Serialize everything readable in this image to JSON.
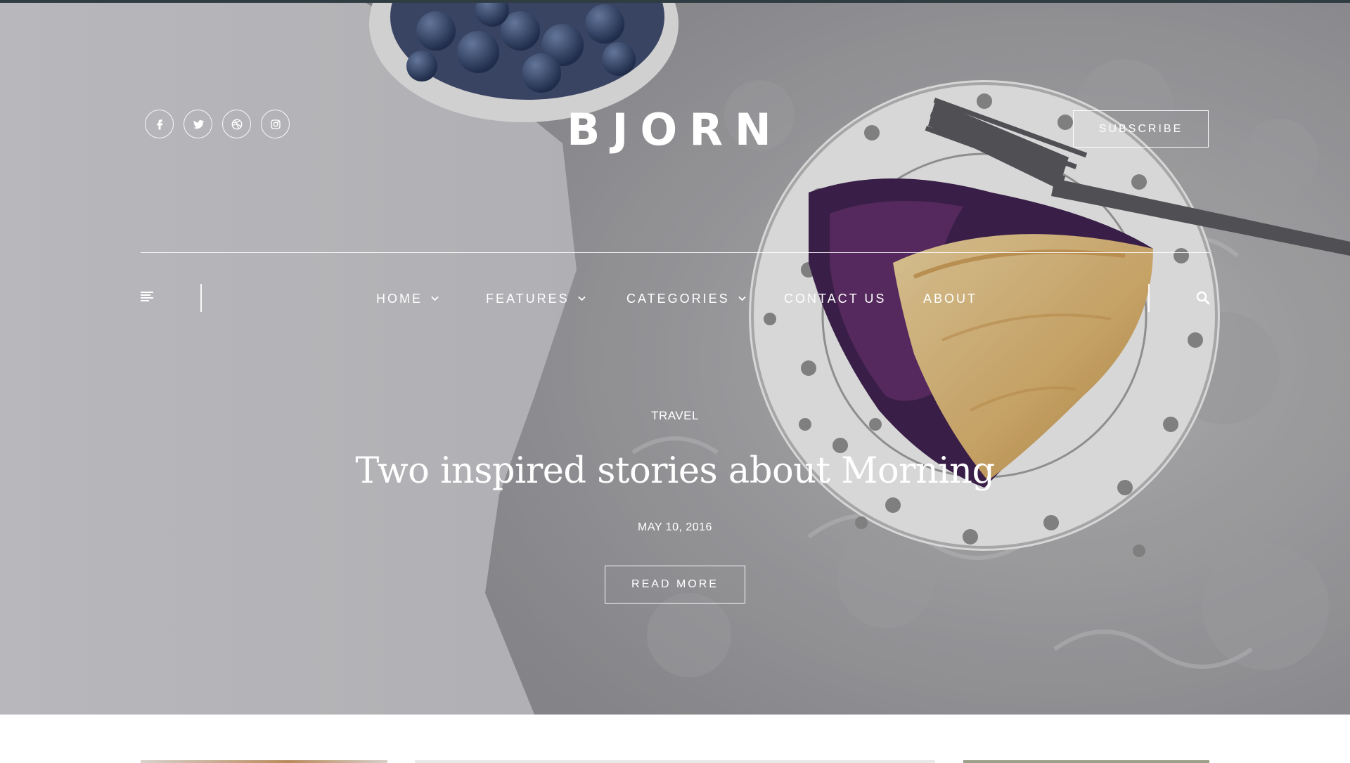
{
  "site": {
    "logo": "BJORN",
    "social": [
      "facebook-icon",
      "twitter-icon",
      "dribbble-icon",
      "instagram-icon"
    ],
    "subscribe_label": "SUBSCRIBE"
  },
  "nav": {
    "items": [
      {
        "label": "HOME",
        "has_dropdown": true
      },
      {
        "label": "FEATURES",
        "has_dropdown": true
      },
      {
        "label": "CATEGORIES",
        "has_dropdown": true
      },
      {
        "label": "CONTACT US",
        "has_dropdown": false
      },
      {
        "label": "ABOUT",
        "has_dropdown": false
      }
    ],
    "menu_icon": "hamburger-menu-icon",
    "search_icon": "search-icon"
  },
  "featured": {
    "category": "TRAVEL",
    "title": "Two inspired stories about Morning",
    "date": "MAY 10, 2016",
    "button_label": "READ MORE"
  },
  "colors": {
    "top_strip": "#2f3d42",
    "text": "#ffffff",
    "page_bg": "#ffffff"
  }
}
